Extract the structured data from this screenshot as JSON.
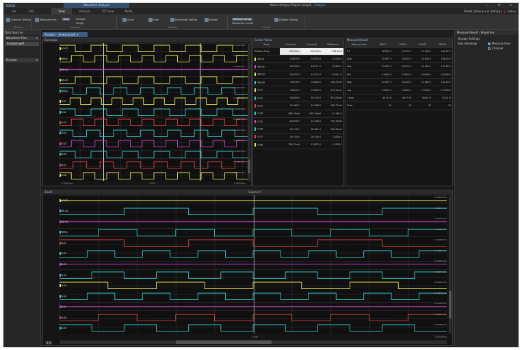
{
  "app": {
    "logo": "IXIEOS",
    "context_tab": "Waveform Analysis",
    "title": "Name Analysis Project sample - ",
    "title_accent": "Analysis",
    "window_controls": "— ❐ ✕"
  },
  "tabs": [
    {
      "label": "File"
    },
    {
      "label": "Edit"
    },
    {
      "label": "View"
    },
    {
      "label": "Analysis"
    },
    {
      "label": "FFT View"
    },
    {
      "label": "Mode"
    }
  ],
  "tabs_right": {
    "label": "Model Options ▾   ⚙ Setting ▾   ❓ Help ▾"
  },
  "ribbon": {
    "groups": [
      {
        "caption": "Channel",
        "buttons": [
          {
            "label": "Channel Setting"
          }
        ]
      },
      {
        "caption": "Analyze",
        "buttons": [
          {
            "label": "Measurement"
          },
          {
            "label": "Ana"
          },
          {
            "label": "Sample"
          },
          {
            "label": "Single"
          }
        ]
      },
      {
        "caption": "Display",
        "buttons": [
          {
            "label": "Scale"
          },
          {
            "label": "Step"
          },
          {
            "label": "Horizontal Setting"
          },
          {
            "label": "Marker"
          }
        ]
      },
      {
        "caption": "Cursor",
        "buttons": [
          {
            "label": "Vertical Cursor"
          },
          {
            "label": "Horizontal Cursor"
          },
          {
            "label": "Display Setting"
          }
        ]
      }
    ]
  },
  "left_panel": {
    "title": "Data Sources",
    "dropdown1": "Waveform Files",
    "file_item": "Analysis.wdf",
    "dropdown2": "Preview"
  },
  "doc_tab": {
    "label": "Analysis - Analysis.wdf ✕"
  },
  "top_plot": {
    "title": "Overview",
    "channels": [
      {
        "name": "VOUT1",
        "color": "#e6e64a",
        "value": "0.0000V/div"
      },
      {
        "name": "PWM1",
        "color": "#e6e64a",
        "value": "0.0000V/div"
      },
      {
        "name": "VBUS2",
        "color": "#d040d0",
        "value": "0.0000V/div"
      },
      {
        "name": "VBUS3",
        "color": "#e6e64a",
        "value": "0.0000V/div"
      },
      {
        "name": "PWM2",
        "color": "#30c8c8",
        "value": "0.0000V/div"
      },
      {
        "name": "CLK1",
        "color": "#e6e64a",
        "value": "0.0000V/div"
      },
      {
        "name": "CLK2",
        "color": "#30c8c8",
        "value": "0.0000V/div"
      },
      {
        "name": "CLK3",
        "color": "#e04040",
        "value": "0.0000V/div"
      },
      {
        "name": "CLK4",
        "color": "#30c8c8",
        "value": "0.0000V/div"
      },
      {
        "name": "CLK5",
        "color": "#d040d0",
        "value": "0.0000V/div"
      },
      {
        "name": "CLK6",
        "color": "#30c8c8",
        "value": "0.0000V/div"
      },
      {
        "name": "CLK7",
        "color": "#e04040",
        "value": "0.0000V/div"
      },
      {
        "name": "CLK8",
        "color": "#e6e64a",
        "value": "0.0000V/div"
      }
    ],
    "x_left": "-0.0000Sec",
    "x_mid": "0.000",
    "x_right": "0.0000Sec"
  },
  "cursor_table": {
    "title": "Cursor Value",
    "headers": [
      "Trace",
      "Cursor(A)",
      "Cursor(B)",
      "Difference"
    ],
    "rows": [
      [
        "Relative Time",
        "-258.00ns",
        "000.00ns",
        "258.00ns"
      ],
      [
        "VBUS1",
        "0.0875 V",
        "3.5025 V",
        "3.4150 V"
      ],
      [
        "VBUS2",
        "95.650 V",
        "100.21 V",
        "3.5800 V"
      ],
      [
        "VBUS3",
        "10.612 V",
        "10.213 V",
        "0.0011 V"
      ],
      [
        "VBUS4",
        "3.8750 V",
        "3.0063 V",
        "000.75mV"
      ],
      [
        "CLK1",
        "3.0812 V",
        "3.0063 V",
        "175.00mV"
      ],
      [
        "CLK2",
        "95.600 V",
        "95.273 V",
        "873.00mV"
      ],
      [
        "CLK3",
        "12.689 V",
        "13.638 V",
        "960.75mV"
      ],
      [
        "CLK4",
        "560.75mV",
        "603.50mV",
        "3.1563 V"
      ],
      [
        "CLK5",
        "-8.7500 V",
        "4.7763 V",
        "787.50mV"
      ],
      [
        "CLK6",
        "50.125 V",
        "90.891 V",
        "000.25mV"
      ],
      [
        "CLK7",
        "29.750 V",
        "28.750 V",
        "1.0000 V"
      ],
      [
        "CLK8",
        "236.75mV",
        "1.5875 V",
        "1.3500 V"
      ]
    ]
  },
  "measure_table": {
    "title": "Measure Result",
    "headers": [
      "Measure Item",
      "VBUS1",
      "VBUS2",
      "VBUS3",
      "VBUS4"
    ],
    "rows": [
      [
        "P-P",
        "28.000 V",
        "113.50 V",
        "15.000 V",
        "185.87 V"
      ],
      [
        "Amp",
        "25.937 V",
        "103.00 V",
        "16.000 V",
        "106.25 V"
      ],
      [
        "Max",
        "23.003 V",
        "103.25 V",
        "16.000 V",
        "103.87 V"
      ],
      [
        "Min",
        "0.0000 V",
        "0.0000 V",
        "0.0000 V",
        "0.0000 V"
      ],
      [
        "High",
        "25.937 V",
        "103.00 V",
        "15.562 V",
        "102.25 V"
      ],
      [
        "Low",
        "0.0000 V",
        "1.0625 V",
        "1.5000 V",
        "1.3000 V"
      ],
      [
        "+Duty",
        "49.30 %",
        "49.75 %",
        "50.67 %",
        "51.05 %"
      ],
      [
        "Pulse",
        "10",
        "10",
        "10",
        "10"
      ]
    ]
  },
  "bottom_plot": {
    "title": "Zoom",
    "sub": "Segment",
    "channels": [
      {
        "name": "VOUT1",
        "color": "#e6e64a",
        "value": "0.0000V/div"
      },
      {
        "name": "VBUS2",
        "color": "#30c8c8",
        "value": "0.0000V/div"
      },
      {
        "name": "VBUS3",
        "color": "#d040d0",
        "value": "0.0000V/div"
      },
      {
        "name": "PWM1",
        "color": "#30c8c8",
        "value": "0.0000V/div"
      },
      {
        "name": "CLK1",
        "color": "#e04040",
        "value": "0.0000V/div"
      },
      {
        "name": "CLK2",
        "color": "#30c8c8",
        "value": "0.0000V/div"
      },
      {
        "name": "CLK3",
        "color": "#d040d0",
        "value": "0.0000V/div"
      },
      {
        "name": "CLK4",
        "color": "#30c8c8",
        "value": "0.0000V/div"
      },
      {
        "name": "CLK5",
        "color": "#e6e64a",
        "value": "0.0000V/div"
      },
      {
        "name": "CLK6",
        "color": "#30c8c8",
        "value": "0.0000V/div"
      },
      {
        "name": "CLK7",
        "color": "#d040d0",
        "value": "0.0000V/div"
      },
      {
        "name": "CLK8",
        "color": "#e04040",
        "value": "0.0000V/div"
      },
      {
        "name": "CLK9",
        "color": "#30c8c8",
        "value": "0.0000V/div"
      }
    ],
    "x_left": "-0.0000Sec",
    "x_mid": "0.000",
    "x_right": "0.0000Sec",
    "zoom_label": "1:1"
  },
  "properties": {
    "title": "Measure Result - Properties",
    "section": "Display Settings",
    "row_label": "Row Headings",
    "opt1": "Measure Item",
    "opt2": "Channel"
  }
}
